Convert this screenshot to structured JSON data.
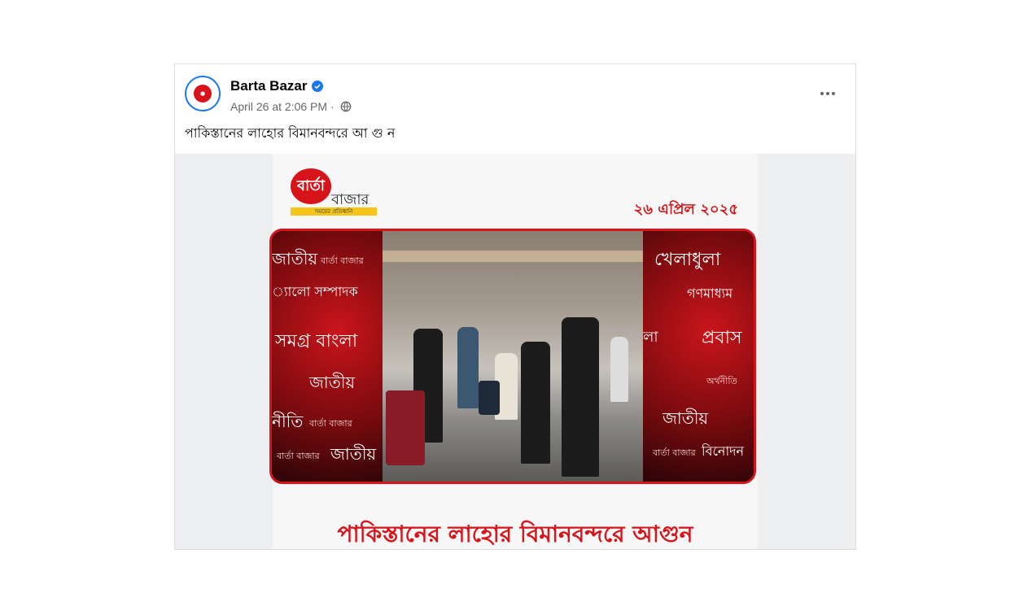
{
  "post": {
    "page_name": "Barta Bazar",
    "timestamp": "April 26 at 2:06 PM",
    "separator": "·",
    "caption": "পাকিস্তানের লাহোর বিমানবন্দরে আ গু ন",
    "icons": {
      "verified": "verified-badge-icon",
      "audience": "globe-icon",
      "more": "more-options-icon"
    },
    "colors": {
      "verified": "#1877f2",
      "brand_red": "#d7141a"
    }
  },
  "media": {
    "logo_text": "বার্তা",
    "logo_word": "বাজার",
    "logo_tagline": "সময়ের প্রতিধ্বনি",
    "date": "২৬ এপ্রিল ২০২৫",
    "left_words": [
      "জাতীয়",
      "বার্তা বাজার",
      "্যালো সম্পাদক",
      "সমগ্র বাংলা",
      "জাতীয়",
      "নীতি",
      "বার্তা বাজার",
      "জাতীয়",
      "বার্তা বাজার"
    ],
    "right_words": [
      "খেলাধুলা",
      "গণমাধ্যম",
      "লা",
      "প্রবাস",
      "অর্থনীতি",
      "জাতীয়",
      "বিনোদন",
      "বার্তা বাজার"
    ],
    "headline": "পাকিস্তানের লাহোর বিমানবন্দরে আগুন"
  }
}
